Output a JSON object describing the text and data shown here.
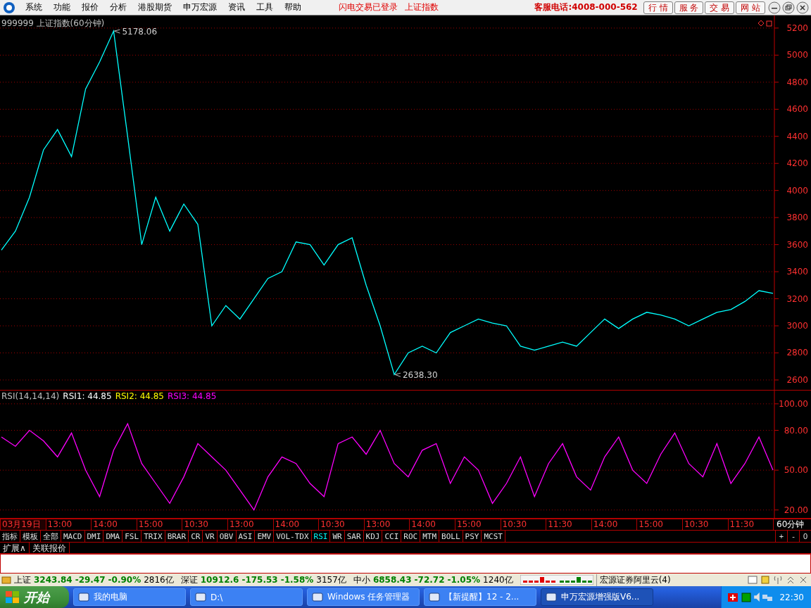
{
  "menu": {
    "items": [
      "系统",
      "功能",
      "报价",
      "分析",
      "港股期货",
      "申万宏源",
      "资讯",
      "工具",
      "帮助"
    ],
    "notices": [
      "闪电交易已登录",
      "上证指数"
    ],
    "hotline": "客服电话:4008-000-562",
    "buttons": [
      "行 情",
      "服 务",
      "交 易",
      "网 站"
    ]
  },
  "price": {
    "title": "999999 上证指数(60分钟)",
    "chart_data": {
      "type": "line",
      "ylim": [
        2527,
        5293
      ],
      "yticks": [
        2600,
        2800,
        3000,
        3200,
        3400,
        3600,
        3800,
        4000,
        4200,
        4400,
        4600,
        4800,
        5000,
        5200
      ],
      "grid": true,
      "series": [
        {
          "color": "#00ffff",
          "values": [
            3560,
            3700,
            3950,
            4300,
            4450,
            4250,
            4750,
            4950,
            5178,
            4400,
            3600,
            3950,
            3700,
            3900,
            3750,
            3000,
            3150,
            3050,
            3200,
            3350,
            3400,
            3620,
            3600,
            3450,
            3600,
            3650,
            3300,
            3000,
            2640,
            2800,
            2850,
            2800,
            2950,
            3000,
            3050,
            3020,
            3000,
            2850,
            2820,
            2850,
            2880,
            2850,
            2950,
            3050,
            2980,
            3050,
            3100,
            3080,
            3050,
            3000,
            3050,
            3100,
            3120,
            3180,
            3260,
            3240
          ]
        }
      ],
      "annotations": [
        "5178.06",
        "2638.30"
      ]
    }
  },
  "rsi": {
    "legend": [
      {
        "text": "RSI(14,14,14)",
        "color": "#c0c0c0"
      },
      {
        "text": "RSI1: 44.85",
        "color": "#ffffff"
      },
      {
        "text": "RSI2: 44.85",
        "color": "#ffff00"
      },
      {
        "text": "RSI3: 44.85",
        "color": "#ff00ff"
      }
    ],
    "chart_data": {
      "type": "line",
      "ylim": [
        14,
        110
      ],
      "yticks": [
        {
          "value": 20,
          "label": "20.00"
        },
        {
          "value": 50,
          "label": "50.00"
        },
        {
          "value": 80,
          "label": "80.00"
        },
        {
          "value": 100,
          "label": "100.00"
        }
      ],
      "grid": true,
      "series": [
        {
          "color": "#ff00ff",
          "values": [
            75,
            68,
            80,
            72,
            60,
            78,
            50,
            30,
            65,
            85,
            55,
            40,
            25,
            45,
            70,
            60,
            50,
            35,
            20,
            45,
            60,
            55,
            40,
            30,
            70,
            75,
            62,
            80,
            55,
            45,
            65,
            70,
            40,
            60,
            50,
            25,
            40,
            60,
            30,
            55,
            70,
            45,
            35,
            60,
            75,
            50,
            40,
            62,
            78,
            55,
            45,
            70,
            40,
            55,
            75,
            50
          ]
        }
      ]
    }
  },
  "time_axis": {
    "labels": [
      "03月19日",
      "13:00",
      "14:00",
      "15:00",
      "10:30",
      "13:00",
      "14:00",
      "10:30",
      "13:00",
      "14:00",
      "15:00",
      "10:30",
      "11:30",
      "14:00",
      "15:00",
      "10:30",
      "11:30"
    ],
    "period": "60分钟"
  },
  "indicator_tabs": [
    {
      "label": "指标",
      "selected": false
    },
    {
      "label": "模板",
      "selected": false
    },
    {
      "label": "全部",
      "selected": false
    },
    {
      "label": "MACD",
      "selected": false
    },
    {
      "label": "DMI",
      "selected": false
    },
    {
      "label": "DMA",
      "selected": false
    },
    {
      "label": "FSL",
      "selected": false
    },
    {
      "label": "TRIX",
      "selected": false
    },
    {
      "label": "BRAR",
      "selected": false
    },
    {
      "label": "CR",
      "selected": false
    },
    {
      "label": "VR",
      "selected": false
    },
    {
      "label": "OBV",
      "selected": false
    },
    {
      "label": "ASI",
      "selected": false
    },
    {
      "label": "EMV",
      "selected": false
    },
    {
      "label": "VOL-TDX",
      "selected": false
    },
    {
      "label": "RSI",
      "selected": true
    },
    {
      "label": "WR",
      "selected": false
    },
    {
      "label": "SAR",
      "selected": false
    },
    {
      "label": "KDJ",
      "selected": false
    },
    {
      "label": "CCI",
      "selected": false
    },
    {
      "label": "ROC",
      "selected": false
    },
    {
      "label": "MTM",
      "selected": false
    },
    {
      "label": "BOLL",
      "selected": false
    },
    {
      "label": "PSY",
      "selected": false
    },
    {
      "label": "MCST",
      "selected": false
    }
  ],
  "zoom_buttons": [
    "+",
    "-",
    "0"
  ],
  "extra_tabs": [
    "扩展∧",
    "关联报价"
  ],
  "status_bar": {
    "markets": [
      {
        "name": "上证",
        "value": "3243.84",
        "change": "-29.47",
        "pct": "-0.90%",
        "volume": "2816亿"
      },
      {
        "name": "深证",
        "value": "10912.6",
        "change": "-175.53",
        "pct": "-1.58%",
        "volume": "3157亿"
      },
      {
        "name": "中小",
        "value": "6858.43",
        "change": "-72.72",
        "pct": "-1.05%",
        "volume": "1240亿"
      }
    ],
    "server": "宏源证券阿里云(4)"
  },
  "taskbar": {
    "start": "开始",
    "tasks": [
      {
        "label": "我的电脑",
        "selected": false
      },
      {
        "label": "D:\\",
        "selected": false
      },
      {
        "label": "Windows 任务管理器",
        "selected": false
      },
      {
        "label": "【新提醒】12 - 2...",
        "selected": false
      },
      {
        "label": "申万宏源增强版V6...",
        "selected": true
      }
    ],
    "clock": "22:30"
  }
}
